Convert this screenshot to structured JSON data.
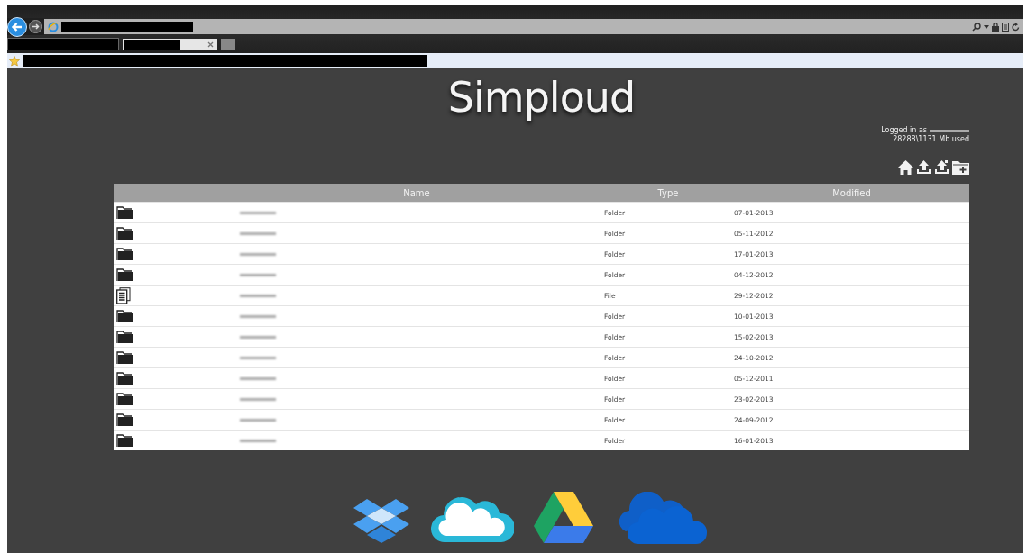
{
  "app": {
    "logo": "Simploud",
    "account": {
      "logged_in_label": "Logged in as",
      "usage": "28288\\1131 Mb used"
    }
  },
  "table": {
    "columns": [
      "Name",
      "Type",
      "Modified"
    ],
    "rows": [
      {
        "kind": "folder",
        "type": "Folder",
        "modified": "07-01-2013"
      },
      {
        "kind": "folder",
        "type": "Folder",
        "modified": "05-11-2012"
      },
      {
        "kind": "folder",
        "type": "Folder",
        "modified": "17-01-2013"
      },
      {
        "kind": "folder",
        "type": "Folder",
        "modified": "04-12-2012"
      },
      {
        "kind": "file",
        "type": "File",
        "modified": "29-12-2012"
      },
      {
        "kind": "folder",
        "type": "Folder",
        "modified": "10-01-2013"
      },
      {
        "kind": "folder",
        "type": "Folder",
        "modified": "15-02-2013"
      },
      {
        "kind": "folder",
        "type": "Folder",
        "modified": "24-10-2012"
      },
      {
        "kind": "folder",
        "type": "Folder",
        "modified": "05-12-2011"
      },
      {
        "kind": "folder",
        "type": "Folder",
        "modified": "23-02-2013"
      },
      {
        "kind": "folder",
        "type": "Folder",
        "modified": "24-09-2012"
      },
      {
        "kind": "folder",
        "type": "Folder",
        "modified": "16-01-2013"
      }
    ]
  }
}
